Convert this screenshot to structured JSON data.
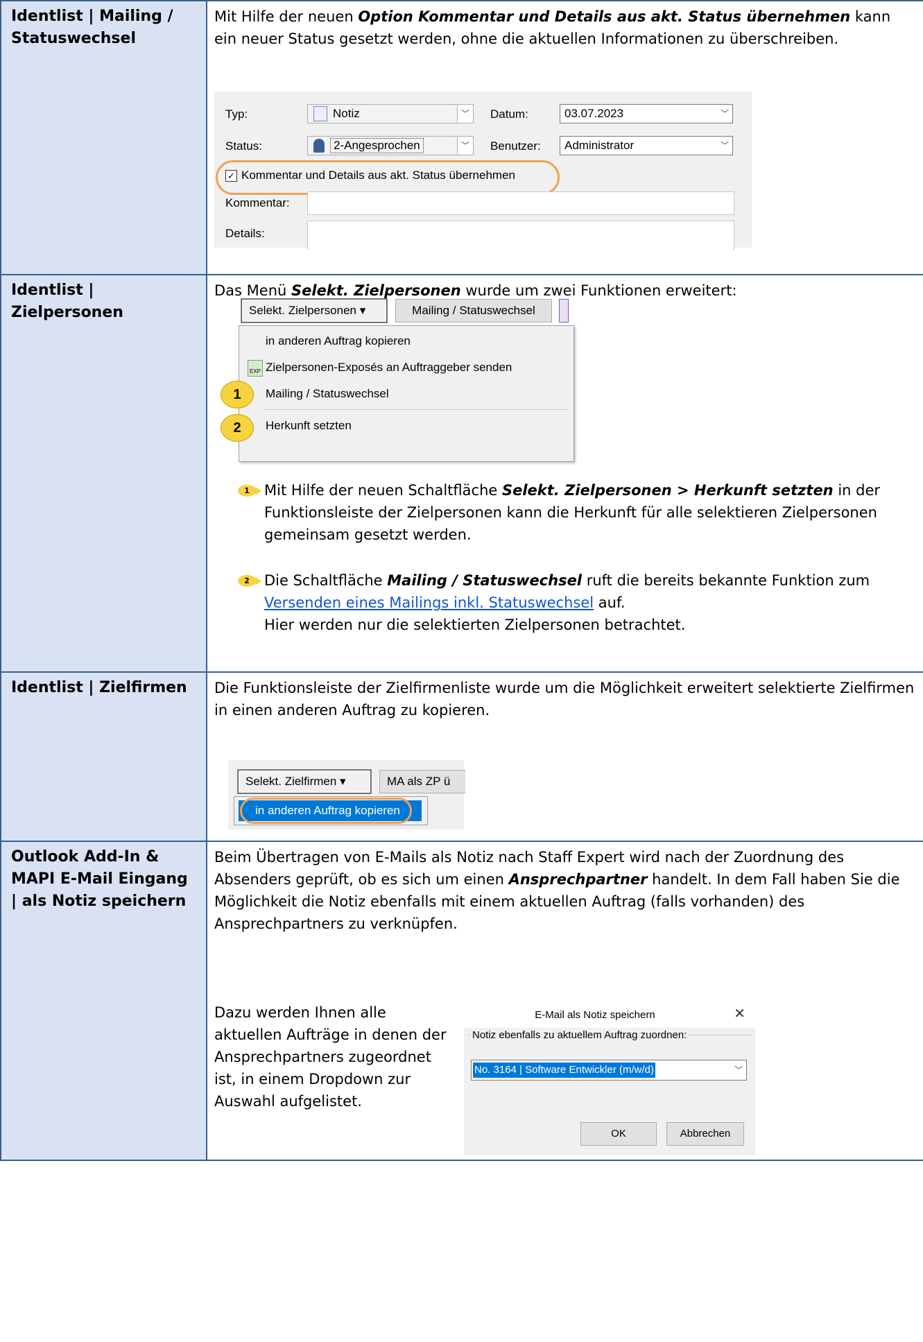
{
  "rows": [
    {
      "label": "Identlist | Mailing / Statuswechsel",
      "intro_1": "Mit Hilfe der neuen ",
      "intro_bi": "Option Kommentar und Details aus akt. Status übernehmen",
      "intro_2": " kann ein neuer Status gesetzt werden, ohne die aktuellen Informationen zu überschreiben.",
      "form": {
        "typ_label": "Typ:",
        "typ_value": "Notiz",
        "datum_label": "Datum:",
        "datum_value": "03.07.2023",
        "status_label": "Status:",
        "status_value": "2-Angesprochen",
        "benutzer_label": "Benutzer:",
        "benutzer_value": "Administrator",
        "checkbox_label": "Kommentar und Details aus akt. Status übernehmen",
        "checkbox_checked": true,
        "kommentar_label": "Kommentar:",
        "details_label": "Details:"
      }
    },
    {
      "label": "Identlist | Zielpersonen",
      "intro_1": "Das Menü  ",
      "intro_bi": "Selekt. Zielpersonen",
      "intro_2": " wurde um zwei Funktionen erweitert:",
      "toolbar": {
        "btn_select": "Selekt. Zielpersonen ▾",
        "btn_mailing": "Mailing / Statuswechsel"
      },
      "menu_items": [
        "in anderen Auftrag kopieren",
        "Zielpersonen-Exposés an Auftraggeber senden",
        "Mailing / Statuswechsel",
        "Herkunft setzten"
      ],
      "callouts": [
        "1",
        "2"
      ],
      "b1_1": "Mit Hilfe der neuen Schaltfläche ",
      "b1_bi": "Selekt. Zielpersonen > Herkunft setzten",
      "b1_2": " in der  Funktionsleiste der Zielpersonen kann die Herkunft für alle selektieren Zielpersonen gemeinsam gesetzt werden.",
      "b2_1": "Die Schaltfläche ",
      "b2_bi": "Mailing / Statuswechsel",
      "b2_2": " ruft die bereits bekannte Funktion zum ",
      "b2_link": "Versenden eines Mailings inkl. Statuswechsel",
      "b2_3": " auf.",
      "b2_4": "Hier werden nur die selektierten Zielpersonen betrachtet."
    },
    {
      "label": "Identlist | Zielfirmen",
      "text": "Die Funktionsleiste der Zielfirmenliste wurde um die Möglichkeit erweitert selektierte Zielfirmen in einen anderen Auftrag zu kopieren.",
      "btn_select": "Selekt. Zielfirmen ▾",
      "btn_ma": "MA als ZP ü",
      "menu_item": "in anderen Auftrag kopieren"
    },
    {
      "label": "Outlook Add-In & MAPI E-Mail Eingang | als Notiz speichern",
      "text_1": "Beim Übertragen von E-Mails als Notiz nach Staff Expert wird nach der Zuordnung des Absenders geprüft, ob es sich um einen ",
      "text_bi": "Ansprechpartner",
      "text_2": " handelt. In dem Fall haben Sie die Möglichkeit die Notiz ebenfalls mit einem aktuellen Auftrag (falls vorhanden) des Ansprechpartners zu verknüpfen.",
      "text_3": "Dazu werden Ihnen alle aktuellen Aufträge in denen der Ansprechpartners zugeordnet ist, in einem Dropdown zur Auswahl aufgelistet.",
      "dialog": {
        "title": "E-Mail als Notiz speichern",
        "close": "✕",
        "group_label": "Notiz ebenfalls zu aktuellem Auftrag zuordnen:",
        "select_value": "No. 3164 | Software Entwickler (m/w/d)",
        "ok": "OK",
        "cancel": "Abbrechen"
      }
    }
  ],
  "colors": {
    "label_bg": "#d9e2f3",
    "border": "#365f91",
    "highlight": "#f2a155",
    "callout": "#f7d33e",
    "link": "#1155cc"
  }
}
